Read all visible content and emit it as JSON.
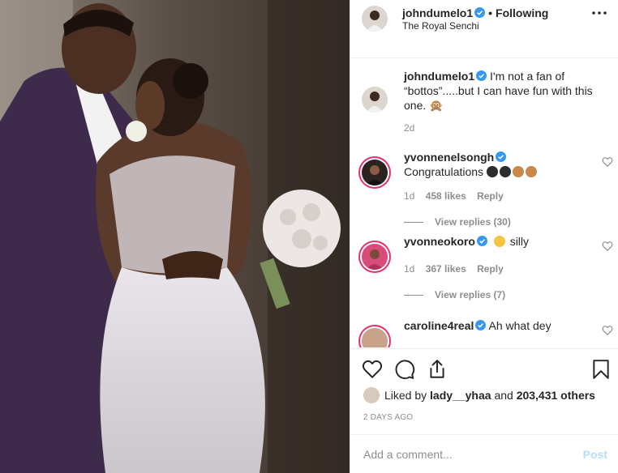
{
  "post": {
    "photo_alt": "Wedding couple photo",
    "owner": {
      "username": "johndumelo1",
      "follow_state": "Following",
      "location": "The Royal Senchi"
    },
    "caption": {
      "username": "johndumelo1",
      "text": "I'm not a fan of “bottos”.....but I can have fun with this one. 🙊",
      "age": "2d"
    },
    "comments": [
      {
        "username": "yvonnenelsongh",
        "text": "Congratulations",
        "age": "1d",
        "likes": "458 likes",
        "reply_label": "Reply",
        "view_replies": "View replies (30)"
      },
      {
        "username": "yvonneokoro",
        "text": "silly",
        "age": "1d",
        "likes": "367 likes",
        "reply_label": "Reply",
        "view_replies": "View replies (7)"
      },
      {
        "username": "caroline4real",
        "text": "Ah what dey"
      }
    ],
    "liked_by": {
      "prefix": "Liked by",
      "user": "lady__yhaa",
      "joiner": "and",
      "others": "203,431 others"
    },
    "timestamp": "2 DAYS AGO",
    "add_comment": {
      "placeholder": "Add a comment...",
      "post_label": "Post"
    }
  },
  "colors": {
    "verified": "#3897f0",
    "link_disabled": "#b2dffc",
    "muted": "#8e8e8e",
    "story_ring": "#e1306c"
  },
  "icons": [
    "more-options-icon",
    "verified-badge-icon",
    "heart-icon",
    "comment-icon",
    "share-icon",
    "bookmark-icon"
  ]
}
